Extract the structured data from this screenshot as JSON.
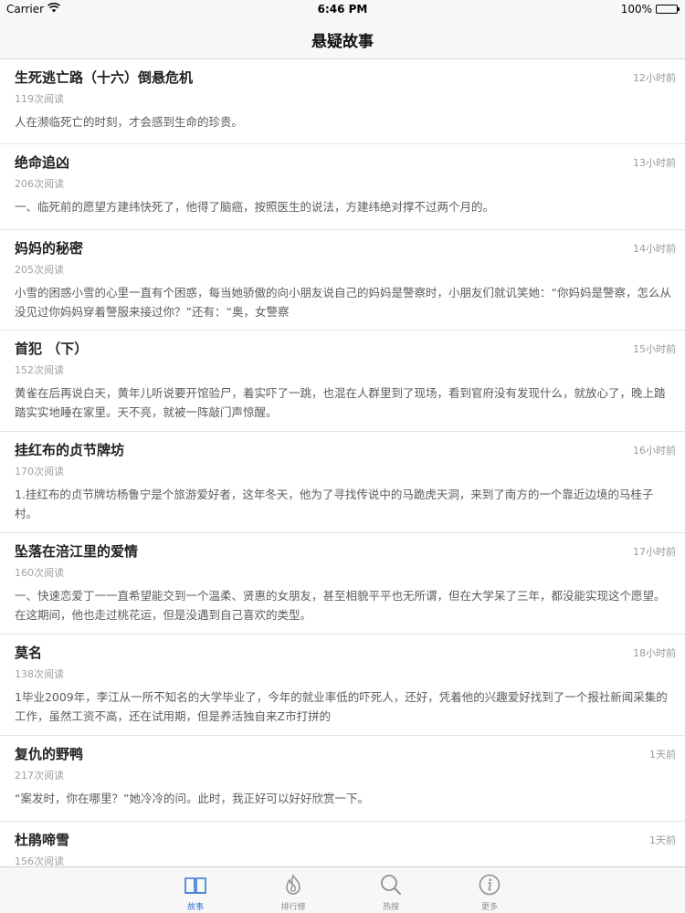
{
  "status_bar": {
    "carrier": "Carrier",
    "time": "6:46 PM",
    "battery": "100%"
  },
  "nav": {
    "title": "悬疑故事"
  },
  "stories": [
    {
      "title": "生死逃亡路（十六）倒悬危机",
      "time": "12小时前",
      "reads": "119次阅读",
      "excerpt": "人在濒临死亡的时刻，才会感到生命的珍贵。"
    },
    {
      "title": "绝命追凶",
      "time": "13小时前",
      "reads": "206次阅读",
      "excerpt": "一、临死前的愿望方建纬快死了，他得了脑癌，按照医生的说法，方建纬绝对撑不过两个月的。"
    },
    {
      "title": "妈妈的秘密",
      "time": "14小时前",
      "reads": "205次阅读",
      "excerpt": "小雪的困惑小雪的心里一直有个困惑，每当她骄傲的向小朋友说自己的妈妈是警察时，小朋友们就讥笑她：“你妈妈是警察，怎么从没见过你妈妈穿着警服来接过你？”还有：“奥，女警察"
    },
    {
      "title": "首犯 （下）",
      "time": "15小时前",
      "reads": "152次阅读",
      "excerpt": "黄雀在后再说白天，黄年儿听说要开馆验尸，着实吓了一跳，也混在人群里到了现场，看到官府没有发现什么，就放心了，晚上踏踏实实地睡在家里。天不亮，就被一阵敲门声惊醒。"
    },
    {
      "title": "挂红布的贞节牌坊",
      "time": "16小时前",
      "reads": "170次阅读",
      "excerpt": "1.挂红布的贞节牌坊杨鲁宁是个旅游爱好者，这年冬天，他为了寻找传说中的马跪虎天洞，来到了南方的一个靠近边境的马桂子村。"
    },
    {
      "title": "坠落在涪江里的爱情",
      "time": "17小时前",
      "reads": "160次阅读",
      "excerpt": "一、快速恋爱丁一一直希望能交到一个温柔、贤惠的女朋友，甚至相貌平平也无所谓，但在大学呆了三年，都没能实现这个愿望。在这期间，他也走过桃花运，但是没遇到自己喜欢的类型。"
    },
    {
      "title": "莫名",
      "time": "18小时前",
      "reads": "138次阅读",
      "excerpt": "1毕业2009年，李江从一所不知名的大学毕业了，今年的就业率低的吓死人，还好，凭着他的兴趣爱好找到了一个报社新闻采集的工作，虽然工资不高，还在试用期，但是养活独自来Z市打拼的"
    },
    {
      "title": "复仇的野鸭",
      "time": "1天前",
      "reads": "217次阅读",
      "excerpt": "“案发时，你在哪里？”她冷冷的问。此时，我正好可以好好欣赏一下。"
    },
    {
      "title": "杜鹃啼雪",
      "time": "1天前",
      "reads": "156次阅读",
      "excerpt": ""
    }
  ],
  "tabs": [
    {
      "label": "故事",
      "icon": "book-icon",
      "active": true
    },
    {
      "label": "排行榜",
      "icon": "flame-icon",
      "active": false
    },
    {
      "label": "热搜",
      "icon": "search-icon",
      "active": false
    },
    {
      "label": "更多",
      "icon": "info-icon",
      "active": false
    }
  ],
  "colors": {
    "accent": "#3478d6",
    "bar_bg": "#f7f7f8",
    "muted": "#9a9a9e"
  }
}
